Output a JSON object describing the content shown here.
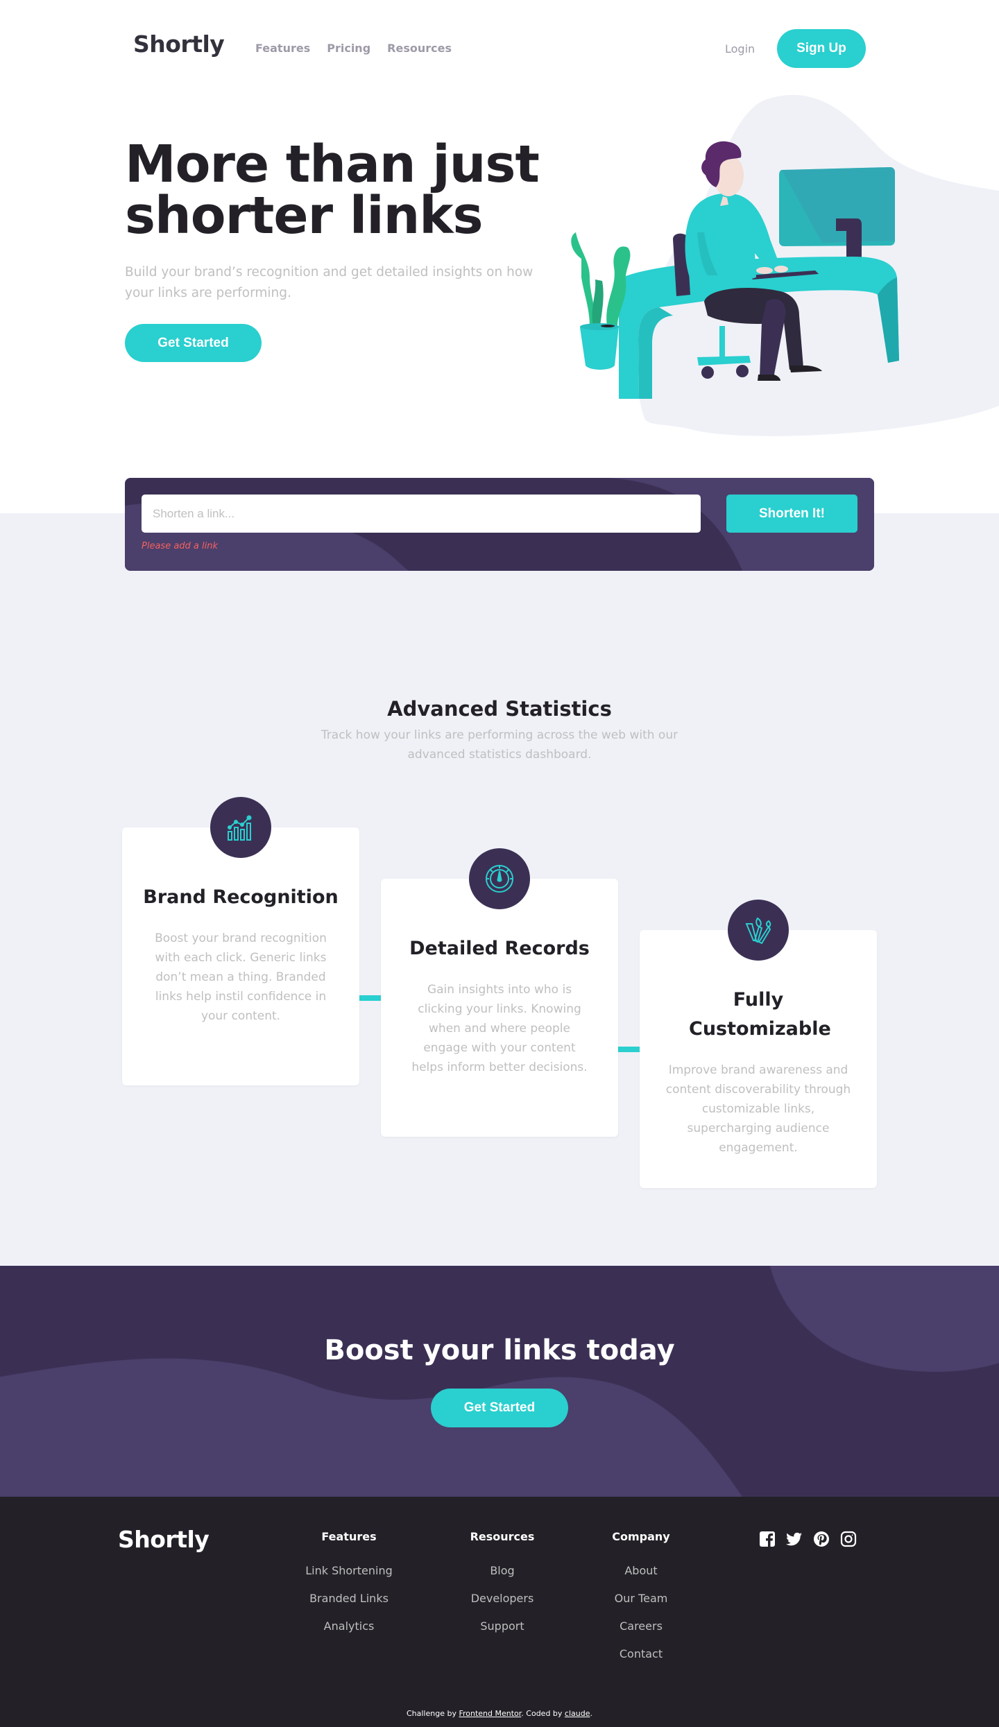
{
  "brand": {
    "logo": "Shortly"
  },
  "nav": {
    "features": "Features",
    "pricing": "Pricing",
    "resources": "Resources"
  },
  "auth": {
    "login": "Login",
    "signup": "Sign Up"
  },
  "hero": {
    "title": "More than just shorter links",
    "subtitle": "Build your brand’s recognition and get detailed insights on how your links are performing.",
    "cta": "Get Started"
  },
  "shorten": {
    "placeholder": "Shorten a link...",
    "button": "Shorten It!",
    "error": "Please add a link"
  },
  "stats": {
    "title": "Advanced Statistics",
    "subtitle": "Track how your links are performing across the web with our advanced statistics dashboard.",
    "cards": [
      {
        "icon": "brand-recognition-icon",
        "title": "Brand Recognition",
        "text": "Boost your brand recognition with each click. Generic links don’t mean a thing. Branded links help instil confidence in your content."
      },
      {
        "icon": "detailed-records-icon",
        "title": "Detailed Records",
        "text": "Gain insights into who is clicking your links. Knowing when and where people engage with your content helps inform better decisions."
      },
      {
        "icon": "fully-customizable-icon",
        "title": "Fully Customizable",
        "text": "Improve brand awareness and content discoverability through customizable links, supercharging audience engagement."
      }
    ]
  },
  "boost": {
    "title": "Boost your links today",
    "cta": "Get Started"
  },
  "footer": {
    "logo": "Shortly",
    "columns": [
      {
        "title": "Features",
        "links": [
          "Link Shortening",
          "Branded Links",
          "Analytics"
        ]
      },
      {
        "title": "Resources",
        "links": [
          "Blog",
          "Developers",
          "Support"
        ]
      },
      {
        "title": "Company",
        "links": [
          "About",
          "Our Team",
          "Careers",
          "Contact"
        ]
      }
    ],
    "socials": [
      "facebook-icon",
      "twitter-icon",
      "pinterest-icon",
      "instagram-icon"
    ],
    "attribution": {
      "prefix": "Challenge by ",
      "fm": "Frontend Mentor",
      "middle": ". Coded by ",
      "author": "claude",
      "suffix": "."
    }
  },
  "colors": {
    "cyan": "#2acfcf",
    "dark_violet": "#3b3054",
    "red": "#f46262",
    "gray": "#bfbfbf",
    "very_dark_violet": "#232127",
    "light_bg": "#eff1f7"
  }
}
